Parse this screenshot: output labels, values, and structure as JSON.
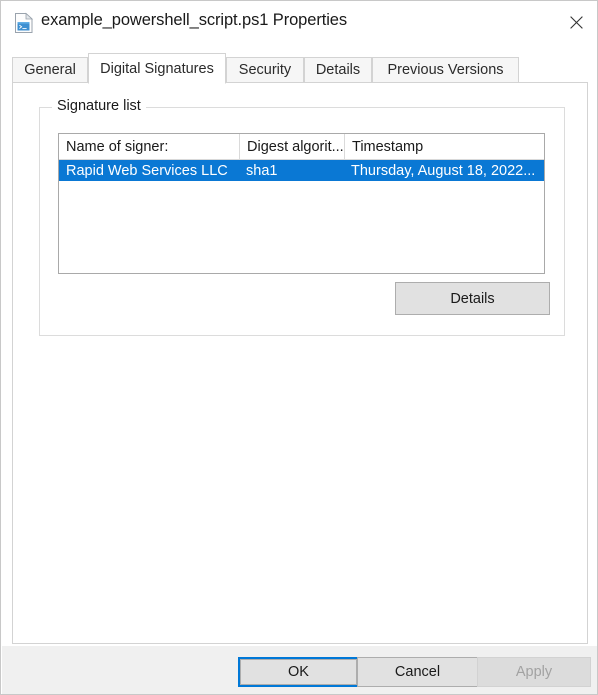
{
  "window": {
    "title": "example_powershell_script.ps1 Properties",
    "icon": "powershell-script-file-icon",
    "close_label": "Close"
  },
  "tabs": [
    {
      "label": "General",
      "active": false
    },
    {
      "label": "Digital Signatures",
      "active": true
    },
    {
      "label": "Security",
      "active": false
    },
    {
      "label": "Details",
      "active": false
    },
    {
      "label": "Previous Versions",
      "active": false
    }
  ],
  "signature_group": {
    "label": "Signature list",
    "columns": [
      {
        "label": "Name of signer:"
      },
      {
        "label": "Digest algorit..."
      },
      {
        "label": "Timestamp"
      }
    ],
    "rows": [
      {
        "selected": true,
        "name_of_signer": "Rapid Web Services LLC",
        "digest_algorithm": "sha1",
        "timestamp": "Thursday, August 18, 2022..."
      }
    ],
    "details_button": "Details"
  },
  "footer": {
    "ok": "OK",
    "cancel": "Cancel",
    "apply": "Apply",
    "apply_enabled": false
  },
  "colors": {
    "selection_blue": "#0a78d4",
    "focus_blue": "#0078d7",
    "dialog_background": "#ffffff",
    "button_bar_background": "#f0f0f0",
    "button_face": "#e1e1e1",
    "disabled_text": "#a2a2a2"
  }
}
